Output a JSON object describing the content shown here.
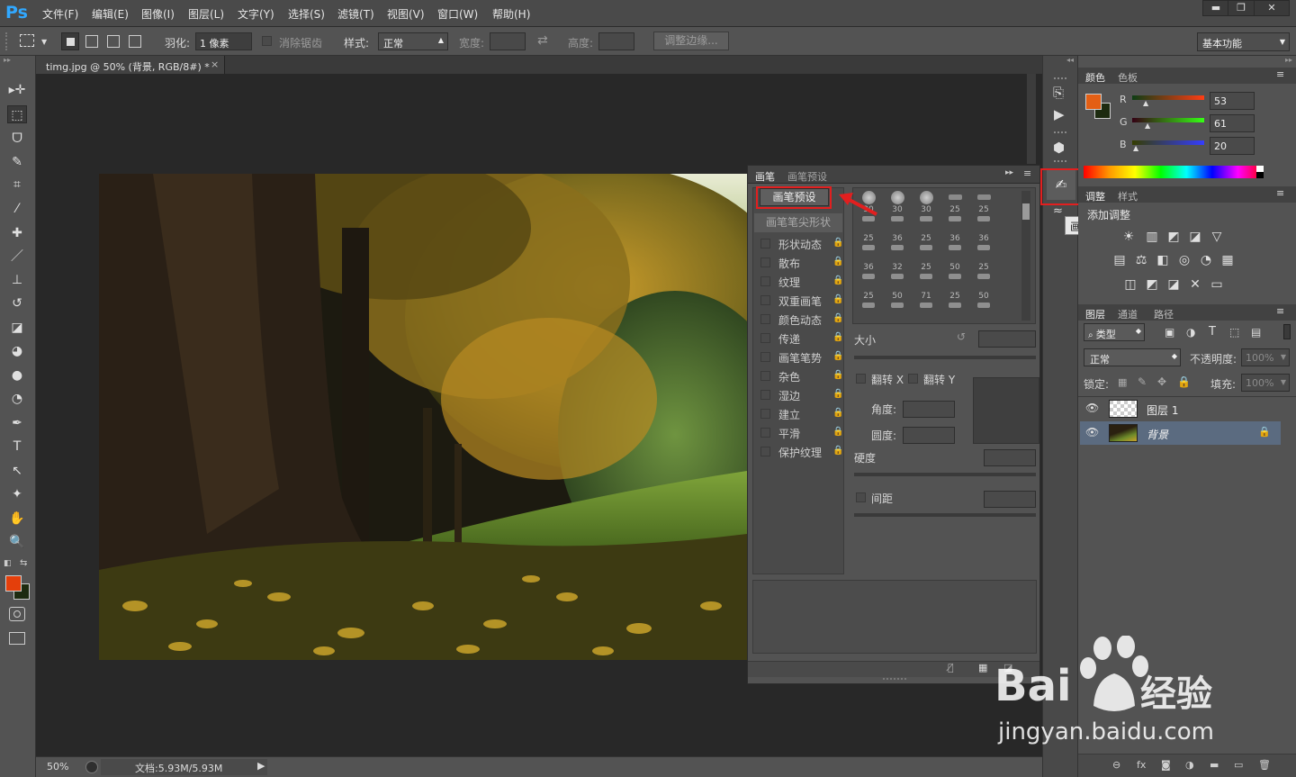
{
  "app": {
    "logo": "Ps"
  },
  "menu": [
    "文件(F)",
    "编辑(E)",
    "图像(I)",
    "图层(L)",
    "文字(Y)",
    "选择(S)",
    "滤镜(T)",
    "视图(V)",
    "窗口(W)",
    "帮助(H)"
  ],
  "window_controls": {
    "minimize": "▬",
    "restore": "❐",
    "close": "✕"
  },
  "options": {
    "feather_label": "羽化:",
    "feather_value": "1 像素",
    "antialias_label": "消除锯齿",
    "style_label": "样式:",
    "style_value": "正常",
    "width_label": "宽度:",
    "height_label": "高度:",
    "refine_edge": "调整边缘...",
    "workspace": "基本功能"
  },
  "document": {
    "tab_title": "timg.jpg @ 50% (背景, RGB/8#) *",
    "tab_close": "×",
    "zoom": "50%",
    "doc_size": "文档:5.93M/5.93M"
  },
  "toolbox": {
    "tools": [
      "move-tool",
      "marquee-tool",
      "lasso-tool",
      "quick-select-tool",
      "crop-tool",
      "eyedropper-tool",
      "healing-tool",
      "brush-tool",
      "stamp-tool",
      "history-brush-tool",
      "eraser-tool",
      "bucket-tool",
      "blur-tool",
      "dodge-tool",
      "pen-tool",
      "type-tool",
      "path-select-tool",
      "shape-tool",
      "hand-tool",
      "zoom-tool"
    ],
    "glyphs": [
      "▸✛",
      "⬚",
      "ᗜ",
      "✎",
      "⌗",
      "⁄",
      "✚",
      "／",
      "⊥",
      "↺",
      "◪",
      "◕",
      "●",
      "◔",
      "✒",
      "T",
      "↖",
      "✦",
      "✋",
      "🔍"
    ],
    "foreground_color": "#E43F0B",
    "background_color": "#1D2B10"
  },
  "brush_panel": {
    "tabs": [
      "画笔",
      "画笔预设"
    ],
    "preset_button": "画笔预设",
    "tip_shape": "画笔笔尖形状",
    "options": [
      "形状动态",
      "散布",
      "纹理",
      "双重画笔",
      "颜色动态",
      "传递",
      "画笔笔势",
      "杂色",
      "湿边",
      "建立",
      "平滑",
      "保护纹理"
    ],
    "tip_sizes": [
      "30",
      "30",
      "30",
      "25",
      "25",
      "25",
      "36",
      "25",
      "36",
      "36",
      "36",
      "32",
      "25",
      "50",
      "25",
      "25",
      "50",
      "71",
      "25",
      "50"
    ],
    "size_label": "大小",
    "flip_x": "翻转 X",
    "flip_y": "翻转 Y",
    "angle_label": "角度:",
    "roundness_label": "圆度:",
    "hardness_label": "硬度",
    "spacing_label": "间距",
    "collapse": "▸▸",
    "menu": "≡"
  },
  "icon_strip": {
    "tooltip": "画笔"
  },
  "color_panel": {
    "tabs": [
      "颜色",
      "色板"
    ],
    "channels": [
      {
        "label": "R",
        "value": "53"
      },
      {
        "label": "G",
        "value": "61"
      },
      {
        "label": "B",
        "value": "20"
      }
    ],
    "foreground": "#E45F14",
    "background": "#1D2B10"
  },
  "adjustments_panel": {
    "tabs": [
      "调整",
      "样式"
    ],
    "title": "添加调整",
    "icons": [
      "brightness-icon",
      "levels-icon",
      "curves-icon",
      "exposure-icon",
      "vibrance-icon",
      "hue-saturation-icon",
      "color-balance-icon",
      "black-white-icon",
      "photo-filter-icon",
      "channel-mixer-icon",
      "color-lookup-icon",
      "invert-icon",
      "posterize-icon",
      "threshold-icon",
      "selective-color-icon",
      "gradient-map-icon"
    ],
    "glyphs": [
      "☀",
      "▥",
      "◩",
      "◪",
      "▽",
      "▤",
      "⚖",
      "◧",
      "◎",
      "◔",
      "▦",
      "◫",
      "◩",
      "◪",
      "✕",
      "▭"
    ]
  },
  "layers_panel": {
    "tabs": [
      "图层",
      "通道",
      "路径"
    ],
    "filter_label": "类型",
    "blend_mode": "正常",
    "opacity_label": "不透明度:",
    "opacity_value": "100%",
    "lock_label": "锁定:",
    "fill_label": "填充:",
    "fill_value": "100%",
    "layers": [
      {
        "name": "图层 1",
        "visible": true,
        "selected": false
      },
      {
        "name": "背景",
        "visible": true,
        "selected": true,
        "locked": true
      }
    ],
    "footer_icons": [
      "⊖",
      "fx",
      "◙",
      "◑",
      "▬",
      "▭",
      "🗑"
    ]
  },
  "watermark": {
    "brand": "Bai",
    "brand2": "经验",
    "url": "jingyan.baidu.com"
  }
}
